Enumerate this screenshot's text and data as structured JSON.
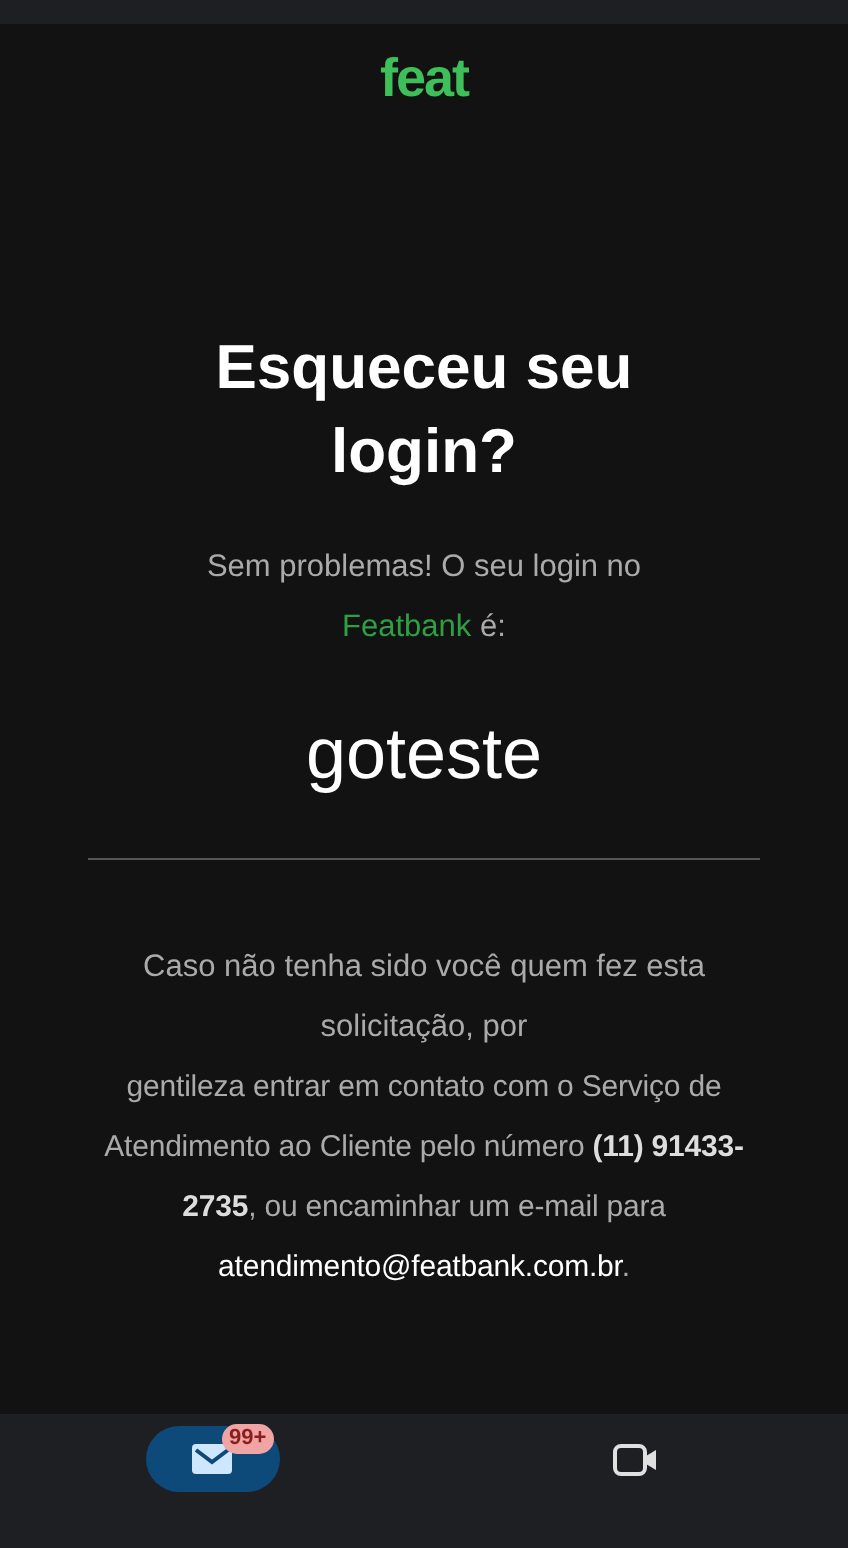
{
  "logo": {
    "text": "feat"
  },
  "title": "Esqueceu seu login?",
  "intro": "Sem problemas! O seu login no",
  "brand_link": "Featbank",
  "intro_end": "é:",
  "login": "goteste",
  "notice_1": "Caso não tenha sido você quem fez esta solicitação, por",
  "notice_2": "gentileza entrar em contato com o Serviço de Atendimento ao Cliente pelo número **(11) 91433-2735**, ou encaminhar um e-mail para",
  "email": "atendimento@featbank.com.br",
  "notice_end": ".",
  "bottom_nav": [
    {
      "kind": "mail",
      "selected": true,
      "badge": "99+"
    },
    {
      "kind": "video",
      "selected": false
    }
  ]
}
